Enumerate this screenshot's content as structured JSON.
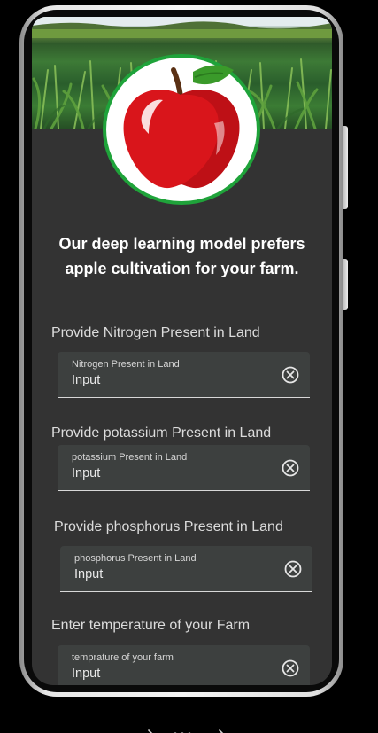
{
  "result": {
    "headline": "Our deep learning model prefers apple cultivation for your farm."
  },
  "fields": [
    {
      "prompt": "Provide Nitrogen Present in Land",
      "floating_label": "Nitrogen Present in Land",
      "value": "Input"
    },
    {
      "prompt": "Provide potassium Present in Land",
      "floating_label": "potassium Present in Land",
      "value": "Input"
    },
    {
      "prompt": "Provide phosphorus Present in Land",
      "floating_label": "phosphorus Present in Land",
      "value": "Input"
    },
    {
      "prompt": "Enter temperature of your Farm",
      "floating_label": "temprature of your farm",
      "value": "Input"
    }
  ],
  "icons": {
    "banner": "cornfield-image",
    "result": "apple-icon",
    "clear": "clear-circle-icon"
  },
  "colors": {
    "screen_background": "#333333",
    "field_background": "#3d403f",
    "badge_ring": "#1fa33a",
    "apple_red": "#d9151b",
    "leaf_green": "#3a9a2a"
  }
}
